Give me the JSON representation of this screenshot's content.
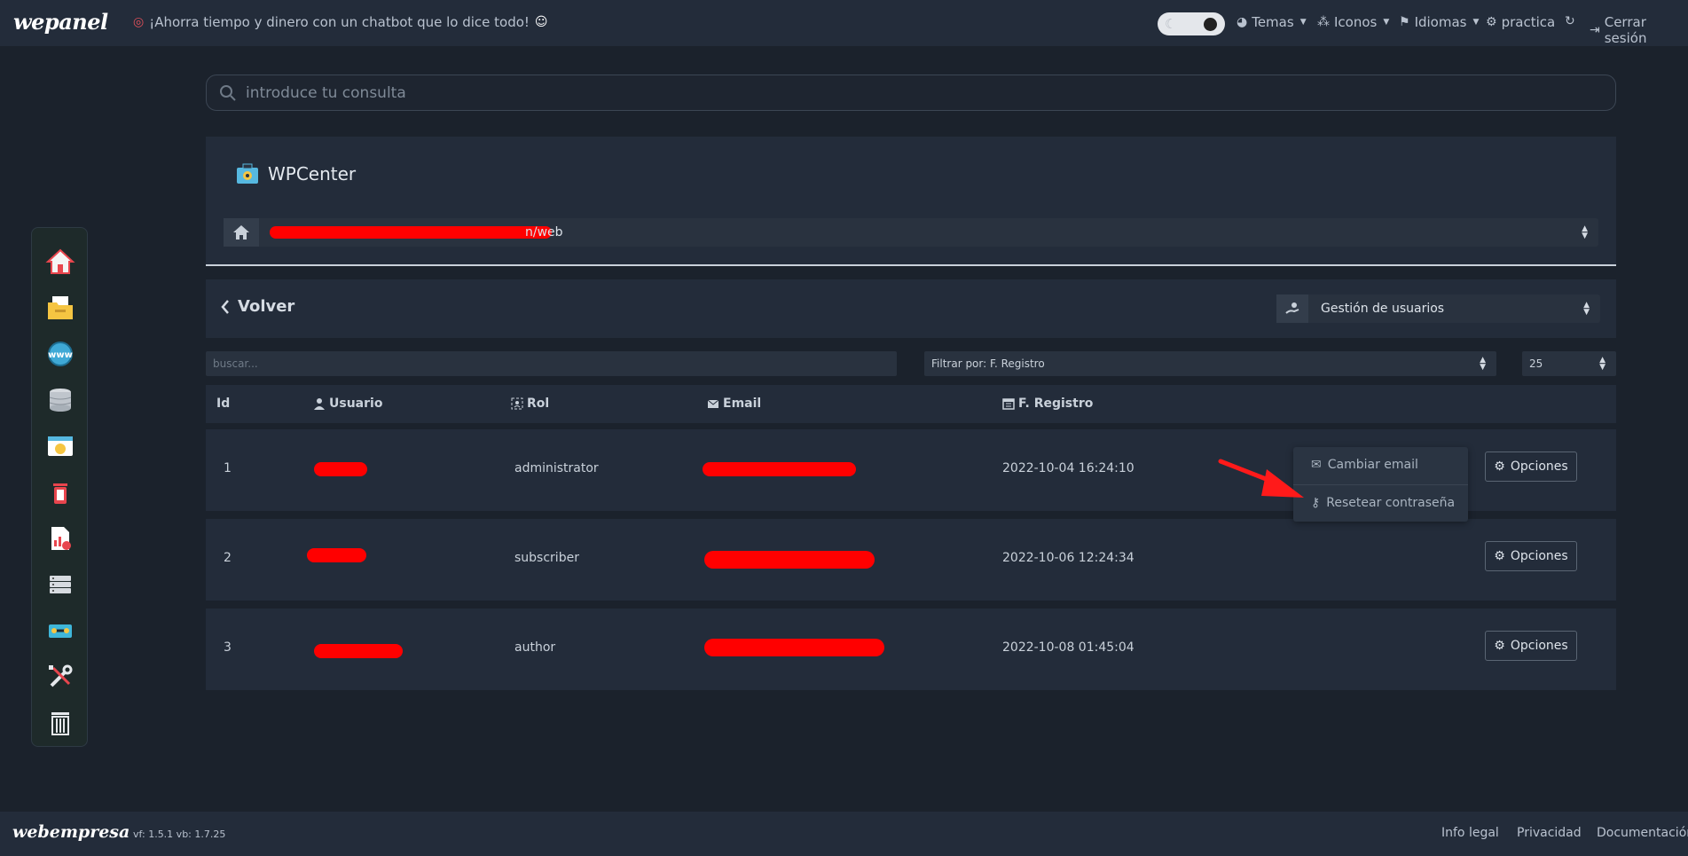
{
  "topnav": {
    "logo": "wepanel",
    "promo": "¡Ahorra tiempo y dinero con un chatbot que lo dice todo!",
    "menus": [
      {
        "label": "Temas",
        "icon": "palette-icon"
      },
      {
        "label": "Iconos",
        "icon": "shapes-icon"
      },
      {
        "label": "Idiomas",
        "icon": "flag-icon"
      },
      {
        "label": "practica",
        "icon": "user-gear-icon"
      },
      {
        "label": "Cerrar sesión",
        "icon": "sign-out-icon"
      }
    ]
  },
  "sidebar": {
    "items": [
      "home-icon",
      "file-manager-icon",
      "domains-icon",
      "database-icon",
      "wordpress-icon",
      "trash-can-icon",
      "stats-icon",
      "server-icon",
      "tools-box-icon",
      "wrench-screwdriver-icon",
      "delete-icon"
    ]
  },
  "search": {
    "placeholder": "introduce tu consulta"
  },
  "wpcenter": {
    "title": "WPCenter",
    "site_url_suffix": "n/web"
  },
  "toolbar": {
    "back_label": "Volver",
    "section_select": "Gestión de usuarios"
  },
  "filters": {
    "search_placeholder": "buscar...",
    "filter_by": "Filtrar por: F. Registro",
    "per_page": "25"
  },
  "table": {
    "headers": {
      "id": "Id",
      "user": "Usuario",
      "role": "Rol",
      "email": "Email",
      "registered": "F. Registro"
    },
    "rows": [
      {
        "id": "1",
        "role": "administrator",
        "registered": "2022-10-04 16:24:10",
        "options": "Opciones"
      },
      {
        "id": "2",
        "role": "subscriber",
        "registered": "2022-10-06 12:24:34",
        "options": "Opciones"
      },
      {
        "id": "3",
        "role": "author",
        "registered": "2022-10-08 01:45:04",
        "options": "Opciones"
      }
    ]
  },
  "dropdown": {
    "change_email": "Cambiar email",
    "reset_password": "Resetear contraseña"
  },
  "footer": {
    "logo": "webempresa",
    "version": "vf: 1.5.1 vb: 1.7.25",
    "links": [
      "Info legal",
      "Privacidad",
      "Documentación"
    ]
  },
  "colors": {
    "background": "#1b222c",
    "panel": "#232c3a",
    "redaction": "#ff0000",
    "annotation_arrow": "#ff1a1a"
  }
}
